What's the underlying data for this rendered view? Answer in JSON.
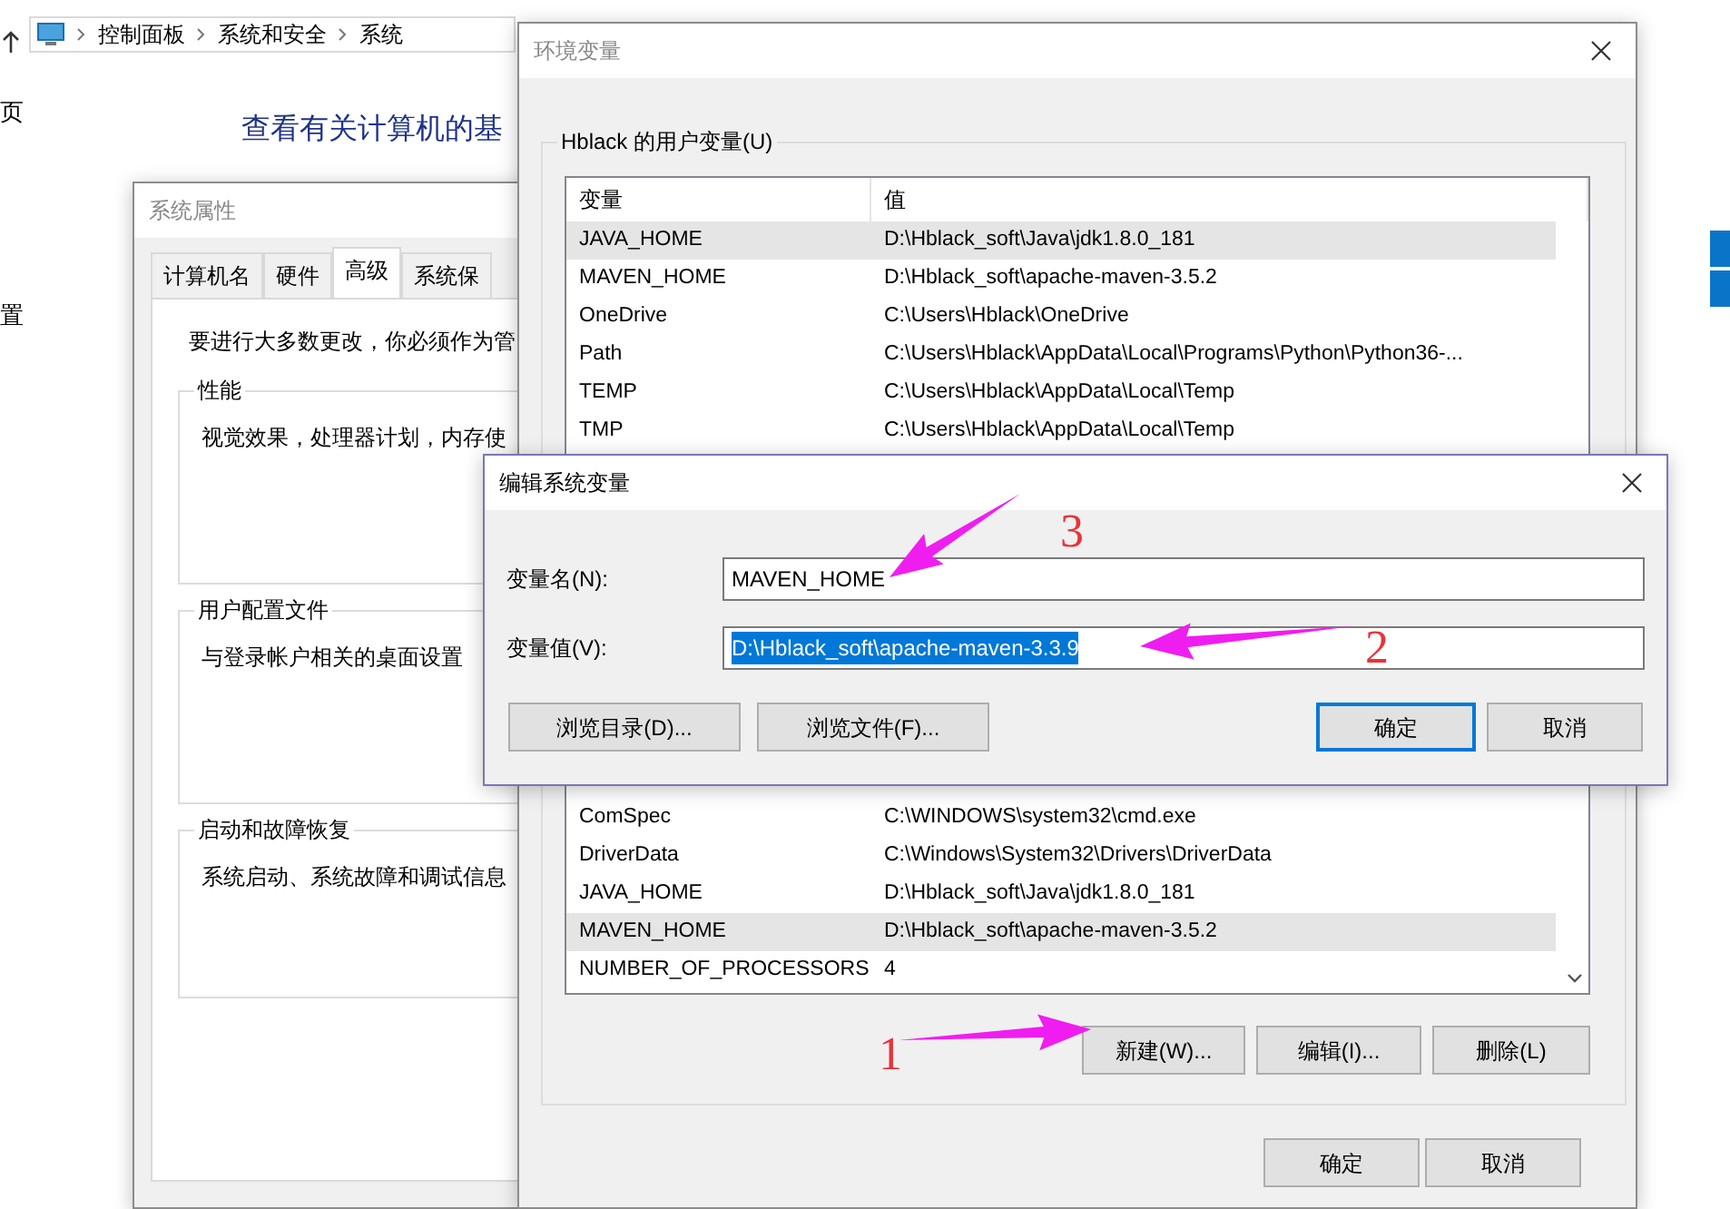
{
  "explorer": {
    "breadcrumb": [
      "控制面板",
      "系统和安全",
      "系统"
    ],
    "sidebar_fragments": [
      "页",
      "置"
    ],
    "heading": "查看有关计算机的基"
  },
  "system_properties": {
    "title": "系统属性",
    "tabs": [
      {
        "label": "计算机名",
        "selected": false
      },
      {
        "label": "硬件",
        "selected": false
      },
      {
        "label": "高级",
        "selected": true
      },
      {
        "label": "系统保",
        "selected": false
      }
    ],
    "notice": "要进行大多数更改，你必须作为管",
    "groups": [
      {
        "legend": "性能",
        "text": "视觉效果，处理器计划，内存使"
      },
      {
        "legend": "用户配置文件",
        "text": "与登录帐户相关的桌面设置"
      },
      {
        "legend": "启动和故障恢复",
        "text": "系统启动、系统故障和调试信息"
      }
    ]
  },
  "environment_variables": {
    "title": "环境变量",
    "user_group": "Hblack 的用户变量(U)",
    "columns": [
      "变量",
      "值"
    ],
    "user_rows": [
      {
        "name": "JAVA_HOME",
        "value": "D:\\Hblack_soft\\Java\\jdk1.8.0_181",
        "selected": true
      },
      {
        "name": "MAVEN_HOME",
        "value": "D:\\Hblack_soft\\apache-maven-3.5.2",
        "selected": false
      },
      {
        "name": "OneDrive",
        "value": "C:\\Users\\Hblack\\OneDrive",
        "selected": false
      },
      {
        "name": "Path",
        "value": "C:\\Users\\Hblack\\AppData\\Local\\Programs\\Python\\Python36-...",
        "selected": false
      },
      {
        "name": "TEMP",
        "value": "C:\\Users\\Hblack\\AppData\\Local\\Temp",
        "selected": false
      },
      {
        "name": "TMP",
        "value": "C:\\Users\\Hblack\\AppData\\Local\\Temp",
        "selected": false
      }
    ],
    "system_rows": [
      {
        "name": "ComSpec",
        "value": "C:\\WINDOWS\\system32\\cmd.exe",
        "selected": false
      },
      {
        "name": "DriverData",
        "value": "C:\\Windows\\System32\\Drivers\\DriverData",
        "selected": false
      },
      {
        "name": "JAVA_HOME",
        "value": "D:\\Hblack_soft\\Java\\jdk1.8.0_181",
        "selected": false
      },
      {
        "name": "MAVEN_HOME",
        "value": "D:\\Hblack_soft\\apache-maven-3.5.2",
        "selected": true
      },
      {
        "name": "NUMBER_OF_PROCESSORS",
        "value": "4",
        "selected": false
      }
    ],
    "system_buttons": [
      "新建(W)...",
      "编辑(I)...",
      "删除(L)"
    ],
    "buttons": [
      "确定",
      "取消"
    ]
  },
  "edit_dialog": {
    "title": "编辑系统变量",
    "fields": [
      {
        "label": "变量名(N):",
        "value": "MAVEN_HOME",
        "selected": false
      },
      {
        "label": "变量值(V):",
        "value": "D:\\Hblack_soft\\apache-maven-3.3.9",
        "selected": true
      }
    ],
    "buttons": [
      {
        "label": "浏览目录(D)...",
        "default": false
      },
      {
        "label": "浏览文件(F)...",
        "default": false
      },
      {
        "label": "确定",
        "default": true
      },
      {
        "label": "取消",
        "default": false
      }
    ]
  },
  "annotations": [
    {
      "label": "3"
    },
    {
      "label": "2"
    },
    {
      "label": "1"
    }
  ]
}
